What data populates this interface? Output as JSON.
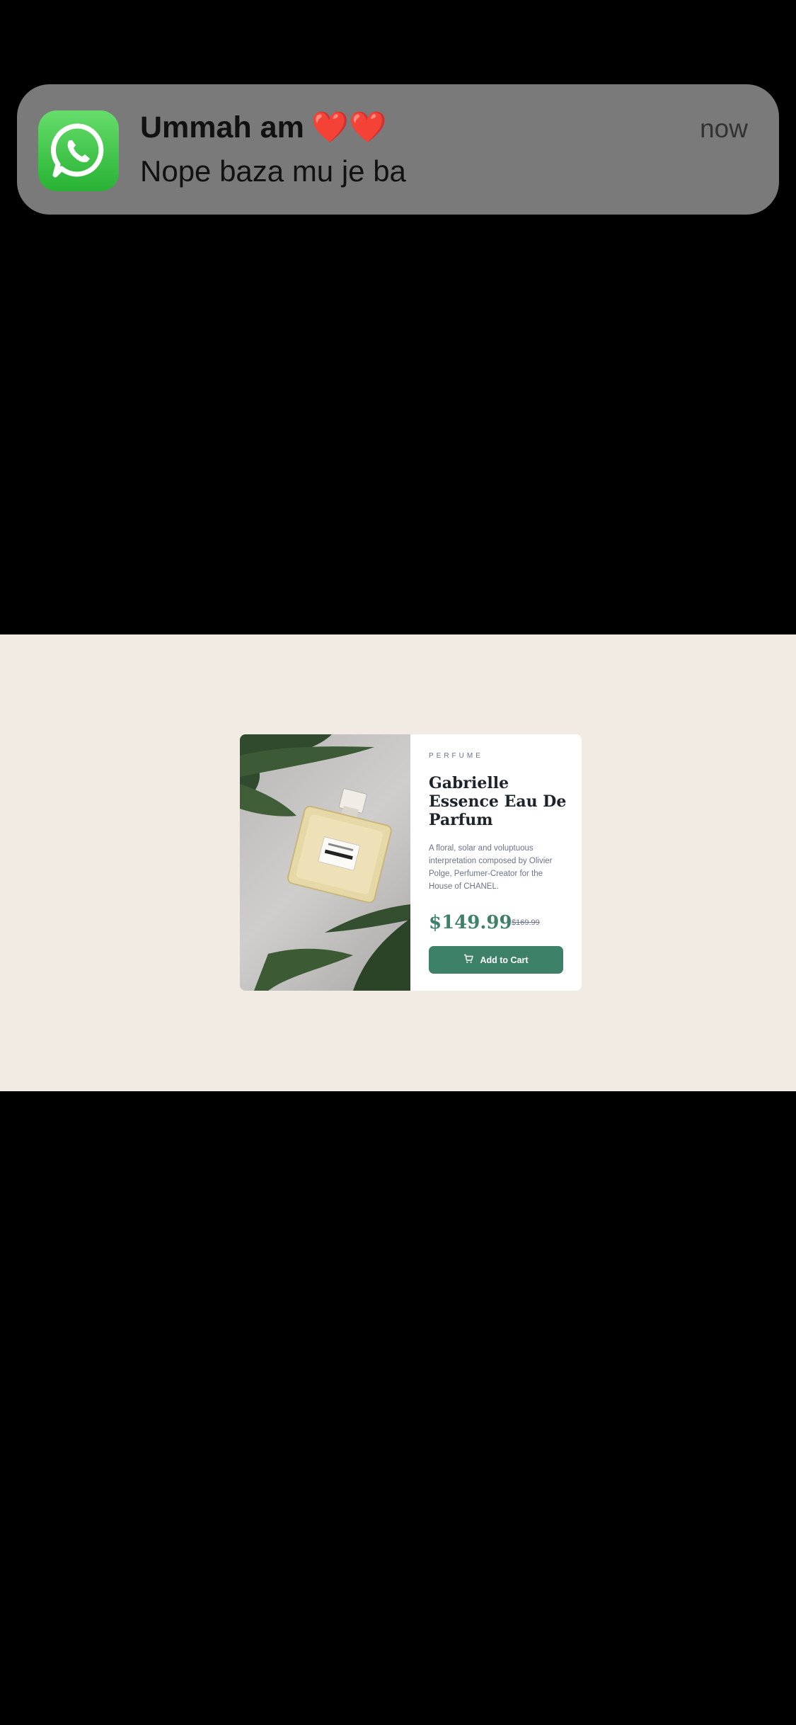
{
  "notification": {
    "app_icon": "whatsapp-icon",
    "sender": "Ummah am",
    "sender_emoji": "❤️❤️",
    "message": "Nope baza mu je ba",
    "time": "now"
  },
  "product": {
    "image": "chanel-gabrielle-bottle-on-leaves",
    "category": "PERFUME",
    "title": "Gabrielle Essence Eau De Parfum",
    "description": "A floral, solar and voluptuous interpretation composed by Olivier Polge, Perfumer-Creator for the House of CHANEL.",
    "price": "$149.99",
    "old_price": "$169.99",
    "cart_icon": "cart-icon",
    "button_label": "Add to Cart"
  },
  "colors": {
    "page_background": "#f2ebe4",
    "accent": "#3d8168",
    "notification_background": "#7a7a7a"
  }
}
